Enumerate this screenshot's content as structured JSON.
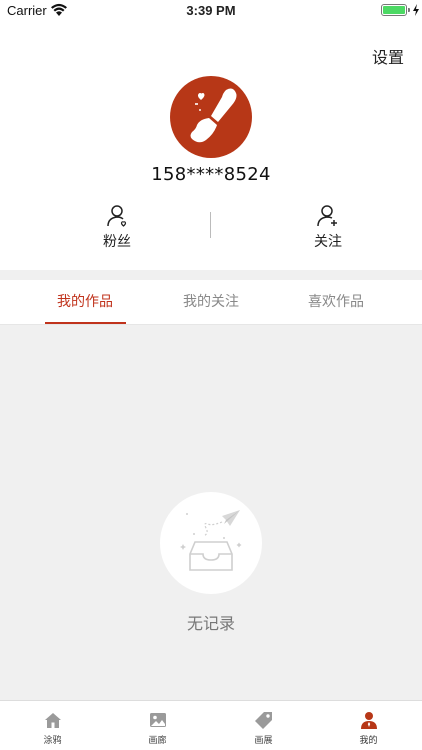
{
  "status_bar": {
    "carrier": "Carrier",
    "time": "3:39 PM",
    "battery_level": 1.0,
    "battery_color": "#4cd964"
  },
  "header": {
    "settings_label": "设置"
  },
  "profile": {
    "avatar_icon": "paintbrush-icon",
    "avatar_bg": "#b73717",
    "username": "158****8524"
  },
  "stats": {
    "fans_label": "粉丝",
    "fans_icon": "user-heart-icon",
    "follow_label": "关注",
    "follow_icon": "user-add-icon"
  },
  "tabs": [
    {
      "label": "我的作品",
      "active": true
    },
    {
      "label": "我的关注",
      "active": false
    },
    {
      "label": "喜欢作品",
      "active": false
    }
  ],
  "accent_color": "#c0331c",
  "empty_state": {
    "icon": "empty-tray-icon",
    "text": "无记录"
  },
  "tabbar": {
    "items": [
      {
        "label": "涂鸦",
        "icon": "home-icon",
        "active": false
      },
      {
        "label": "画廊",
        "icon": "image-icon",
        "active": false
      },
      {
        "label": "画展",
        "icon": "tag-icon",
        "active": false
      },
      {
        "label": "我的",
        "icon": "person-icon",
        "active": true
      }
    ]
  }
}
